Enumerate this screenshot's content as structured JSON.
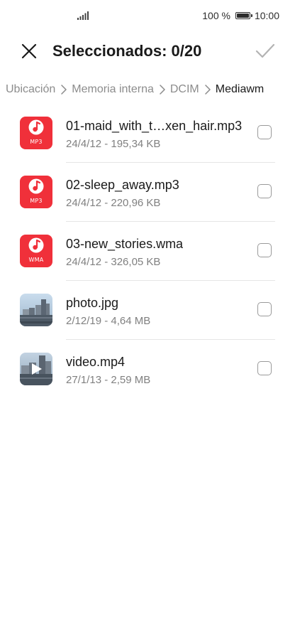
{
  "status_bar": {
    "battery_percent": "100 %",
    "time": "10:00",
    "signal_icon": "signal-icon",
    "battery_icon": "battery-icon"
  },
  "header": {
    "title": "Seleccionados: 0/20",
    "close_icon": "close-icon",
    "confirm_icon": "check-icon"
  },
  "breadcrumb": {
    "items": [
      "Ubicación",
      "Memoria interna",
      "DCIM",
      "Mediawm"
    ]
  },
  "files": [
    {
      "name": "01-maid_with_t…xen_hair.mp3",
      "meta": "24/4/12 - 195,34 KB",
      "type": "audio",
      "ext": "MP3",
      "checked": false
    },
    {
      "name": "02-sleep_away.mp3",
      "meta": "24/4/12 - 220,96 KB",
      "type": "audio",
      "ext": "MP3",
      "checked": false
    },
    {
      "name": "03-new_stories.wma",
      "meta": "24/4/12 - 326,05 KB",
      "type": "audio",
      "ext": "WMA",
      "checked": false
    },
    {
      "name": "photo.jpg",
      "meta": "2/12/19 - 4,64 MB",
      "type": "image",
      "checked": false
    },
    {
      "name": "video.mp4",
      "meta": "27/1/13 - 2,59 MB",
      "type": "video",
      "checked": false
    }
  ],
  "colors": {
    "audio_icon_bg": "#f0303a",
    "text_primary": "#1a1a1a",
    "text_secondary": "#808080"
  }
}
